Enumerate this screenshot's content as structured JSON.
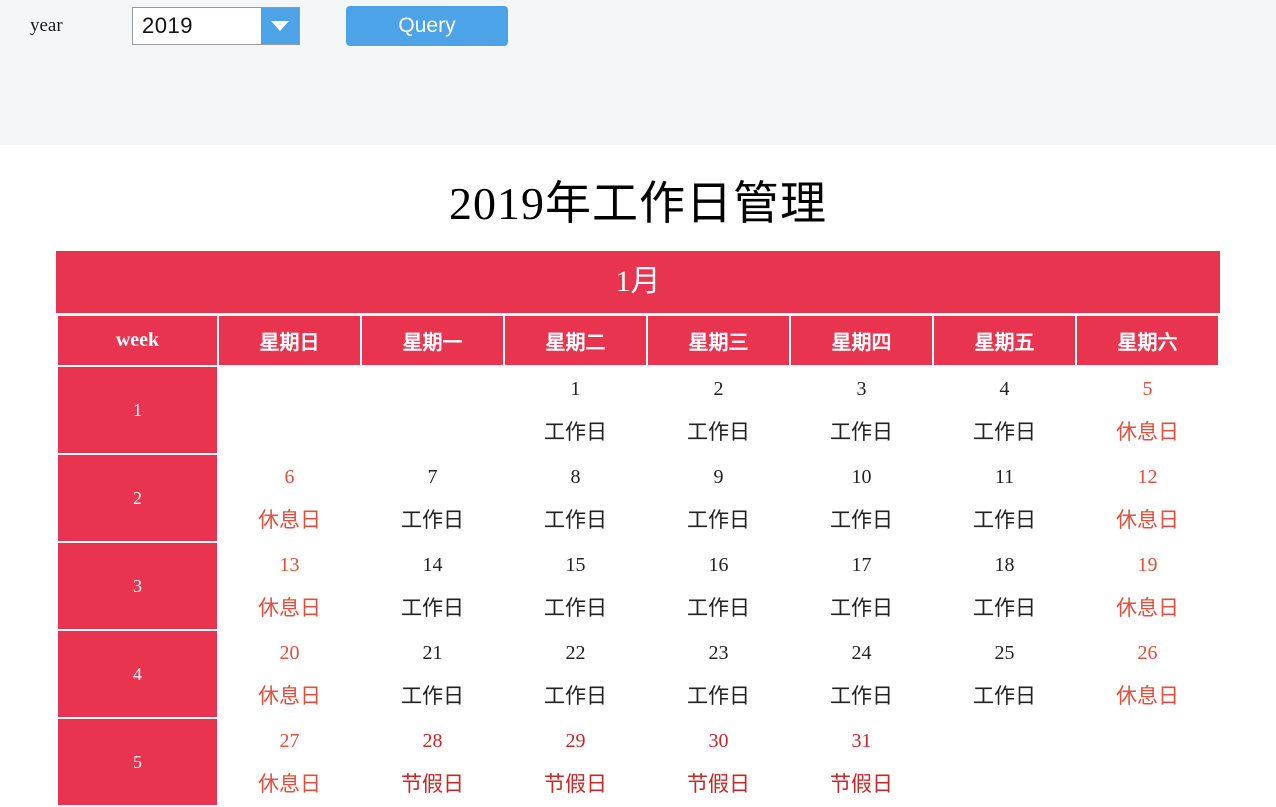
{
  "toolbar": {
    "year_label": "year",
    "year_value": "2019",
    "year_options": [
      "2019"
    ],
    "dropdown_icon": "chevron-down-icon",
    "query_label": "Query"
  },
  "page_title": "2019年工作日管理",
  "calendar": {
    "month_label": "1月",
    "week_column_header": "week",
    "weekday_headers": [
      "星期日",
      "星期一",
      "星期二",
      "星期三",
      "星期四",
      "星期五",
      "星期六"
    ],
    "colors": {
      "header_red": "#e8344f",
      "rest_text": "#e0503c",
      "holiday_text": "#c42828",
      "work_text": "#222222",
      "accent_blue": "#4da3e8"
    },
    "type_labels": {
      "work": "工作日",
      "rest": "休息日",
      "holiday": "节假日"
    },
    "rows": [
      {
        "week": "1",
        "days": [
          {
            "num": "",
            "type": "",
            "kind": "empty"
          },
          {
            "num": "",
            "type": "",
            "kind": "empty"
          },
          {
            "num": "1",
            "type": "工作日",
            "kind": "work"
          },
          {
            "num": "2",
            "type": "工作日",
            "kind": "work"
          },
          {
            "num": "3",
            "type": "工作日",
            "kind": "work"
          },
          {
            "num": "4",
            "type": "工作日",
            "kind": "work"
          },
          {
            "num": "5",
            "type": "休息日",
            "kind": "rest"
          }
        ]
      },
      {
        "week": "2",
        "days": [
          {
            "num": "6",
            "type": "休息日",
            "kind": "rest"
          },
          {
            "num": "7",
            "type": "工作日",
            "kind": "work"
          },
          {
            "num": "8",
            "type": "工作日",
            "kind": "work"
          },
          {
            "num": "9",
            "type": "工作日",
            "kind": "work"
          },
          {
            "num": "10",
            "type": "工作日",
            "kind": "work"
          },
          {
            "num": "11",
            "type": "工作日",
            "kind": "work"
          },
          {
            "num": "12",
            "type": "休息日",
            "kind": "rest"
          }
        ]
      },
      {
        "week": "3",
        "days": [
          {
            "num": "13",
            "type": "休息日",
            "kind": "rest"
          },
          {
            "num": "14",
            "type": "工作日",
            "kind": "work"
          },
          {
            "num": "15",
            "type": "工作日",
            "kind": "work"
          },
          {
            "num": "16",
            "type": "工作日",
            "kind": "work"
          },
          {
            "num": "17",
            "type": "工作日",
            "kind": "work"
          },
          {
            "num": "18",
            "type": "工作日",
            "kind": "work"
          },
          {
            "num": "19",
            "type": "休息日",
            "kind": "rest"
          }
        ]
      },
      {
        "week": "4",
        "days": [
          {
            "num": "20",
            "type": "休息日",
            "kind": "rest"
          },
          {
            "num": "21",
            "type": "工作日",
            "kind": "work"
          },
          {
            "num": "22",
            "type": "工作日",
            "kind": "work"
          },
          {
            "num": "23",
            "type": "工作日",
            "kind": "work"
          },
          {
            "num": "24",
            "type": "工作日",
            "kind": "work"
          },
          {
            "num": "25",
            "type": "工作日",
            "kind": "work"
          },
          {
            "num": "26",
            "type": "休息日",
            "kind": "rest"
          }
        ]
      },
      {
        "week": "5",
        "days": [
          {
            "num": "27",
            "type": "休息日",
            "kind": "rest"
          },
          {
            "num": "28",
            "type": "节假日",
            "kind": "holiday"
          },
          {
            "num": "29",
            "type": "节假日",
            "kind": "holiday"
          },
          {
            "num": "30",
            "type": "节假日",
            "kind": "holiday"
          },
          {
            "num": "31",
            "type": "节假日",
            "kind": "holiday"
          },
          {
            "num": "",
            "type": "",
            "kind": "empty"
          },
          {
            "num": "",
            "type": "",
            "kind": "empty"
          }
        ]
      }
    ]
  }
}
